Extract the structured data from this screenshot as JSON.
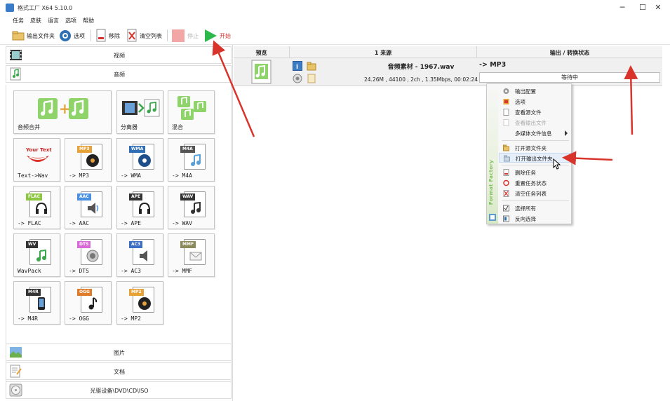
{
  "window": {
    "title": "格式工厂 X64 5.10.0",
    "minimize_glyph": "─",
    "maximize_glyph": "☐",
    "close_glyph": "✕"
  },
  "menu": [
    "任务",
    "皮肤",
    "语言",
    "选项",
    "帮助"
  ],
  "toolbar": {
    "output_folder": "输出文件夹",
    "options": "选项",
    "remove": "移除",
    "clear_list": "清空列表",
    "stop": "停止",
    "start": "开始"
  },
  "sidebar": {
    "video": "视频",
    "audio": "音频",
    "picture": "图片",
    "document": "文档",
    "disc": "光驱设备\\DVD\\CD\\ISO"
  },
  "tools": [
    {
      "label": "音频合并",
      "icon": "audio-merge-icon"
    },
    {
      "label": "分离器",
      "icon": "splitter-icon"
    },
    {
      "label": "混合",
      "icon": "mix-icon"
    },
    {
      "label": "Text->Wav",
      "icon": "text-to-wav-icon",
      "tag": "Your Text"
    },
    {
      "label": "-> MP3",
      "icon": "mp3-file-icon",
      "tag": "MP3",
      "tag_color": "#e8a23a"
    },
    {
      "label": "-> WMA",
      "icon": "wma-file-icon",
      "tag": "WMA",
      "tag_color": "#2f6fb5"
    },
    {
      "label": "-> M4A",
      "icon": "m4a-file-icon",
      "tag": "M4A",
      "tag_color": "#555555"
    },
    {
      "label": "-> FLAC",
      "icon": "flac-file-icon",
      "tag": "FLAC",
      "tag_color": "#8cc63f"
    },
    {
      "label": "-> AAC",
      "icon": "aac-file-icon",
      "tag": "AAC",
      "tag_color": "#4a90e2"
    },
    {
      "label": "-> APE",
      "icon": "ape-file-icon",
      "tag": "APE",
      "tag_color": "#333333"
    },
    {
      "label": "-> WAV",
      "icon": "wav-file-icon",
      "tag": "WAV",
      "tag_color": "#333333"
    },
    {
      "label": "WavPack",
      "icon": "wavpack-file-icon",
      "tag": "WV",
      "tag_color": "#333333"
    },
    {
      "label": "-> DTS",
      "icon": "dts-file-icon",
      "tag": "DTS",
      "tag_color": "#d86ad8"
    },
    {
      "label": "-> AC3",
      "icon": "ac3-file-icon",
      "tag": "AC3",
      "tag_color": "#3a6fc4"
    },
    {
      "label": "-> MMF",
      "icon": "mmf-file-icon",
      "tag": "MMF",
      "tag_color": "#8a8a5a"
    },
    {
      "label": "-> M4R",
      "icon": "m4r-file-icon",
      "tag": "M4R",
      "tag_color": "#333333"
    },
    {
      "label": "-> OGG",
      "icon": "ogg-file-icon",
      "tag": "OGG",
      "tag_color": "#e07b2a"
    },
    {
      "label": "-> MP2",
      "icon": "mp2-file-icon",
      "tag": "MP2",
      "tag_color": "#e8a23a"
    }
  ],
  "task_list": {
    "columns": [
      "预览",
      "1 来源",
      "输出 / 转换状态"
    ],
    "rows": [
      {
        "source_name": "音频素材 - 1967.wav",
        "source_info": "24.26M , 44100 , 2ch , 1.35Mbps, 00:02:24",
        "output": "-> MP3",
        "status": "等待中"
      }
    ]
  },
  "context_menu": {
    "brand": "Format Factory",
    "items": [
      {
        "label": "输出配置",
        "icon": "output-config-icon"
      },
      {
        "label": "选项",
        "icon": "options-icon"
      },
      {
        "label": "查看源文件",
        "icon": "view-source-icon"
      },
      {
        "label": "查看输出文件",
        "icon": "view-output-icon",
        "disabled": true
      },
      {
        "label": "多媒体文件信息",
        "icon": "media-info-icon",
        "submenu": true
      },
      {
        "label": "打开源文件夹",
        "icon": "folder-icon"
      },
      {
        "label": "打开输出文件夹",
        "icon": "output-folder-icon",
        "highlighted": true
      },
      {
        "label": "删除任务",
        "icon": "delete-task-icon"
      },
      {
        "label": "重置任务状态",
        "icon": "reset-status-icon"
      },
      {
        "label": "清空任务列表",
        "icon": "clear-list-icon"
      },
      {
        "label": "选择所有",
        "icon": "select-all-icon"
      },
      {
        "label": "反向选择",
        "icon": "invert-selection-icon"
      }
    ]
  },
  "colors": {
    "accent_red": "#d9342b",
    "start_green": "#2db84b",
    "highlight": "#e5eef9"
  }
}
